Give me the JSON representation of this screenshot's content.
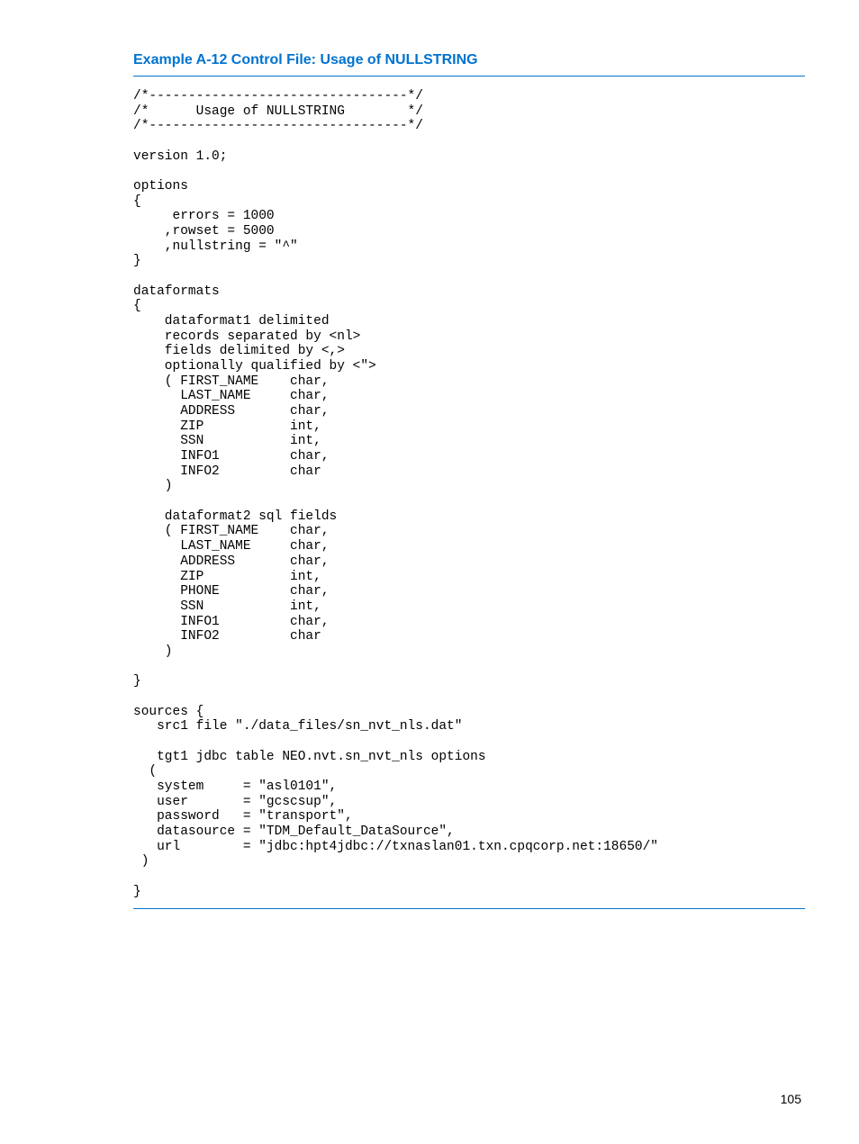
{
  "title": "Example A-12 Control File: Usage of NULLSTRING",
  "code": "/*---------------------------------*/\n/*      Usage of NULLSTRING        */\n/*---------------------------------*/\n\nversion 1.0;\n\noptions\n{\n     errors = 1000\n    ,rowset = 5000\n    ,nullstring = \"^\"\n}\n\ndataformats\n{\n    dataformat1 delimited\n    records separated by <nl>\n    fields delimited by <,>\n    optionally qualified by <\">\n    ( FIRST_NAME    char,\n      LAST_NAME     char,\n      ADDRESS       char,\n      ZIP           int,\n      SSN           int,\n      INFO1         char,\n      INFO2         char\n    )\n\n    dataformat2 sql fields\n    ( FIRST_NAME    char,\n      LAST_NAME     char,\n      ADDRESS       char,\n      ZIP           int,\n      PHONE         char,\n      SSN           int,\n      INFO1         char,\n      INFO2         char\n    )\n\n}\n\nsources {\n   src1 file \"./data_files/sn_nvt_nls.dat\"\n\n   tgt1 jdbc table NEO.nvt.sn_nvt_nls options\n  (\n   system     = \"asl0101\",\n   user       = \"gcscsup\",\n   password   = \"transport\",\n   datasource = \"TDM_Default_DataSource\",\n   url        = \"jdbc:hpt4jdbc://txnaslan01.txn.cpqcorp.net:18650/\"\n )\n\n}",
  "page_number": "105"
}
